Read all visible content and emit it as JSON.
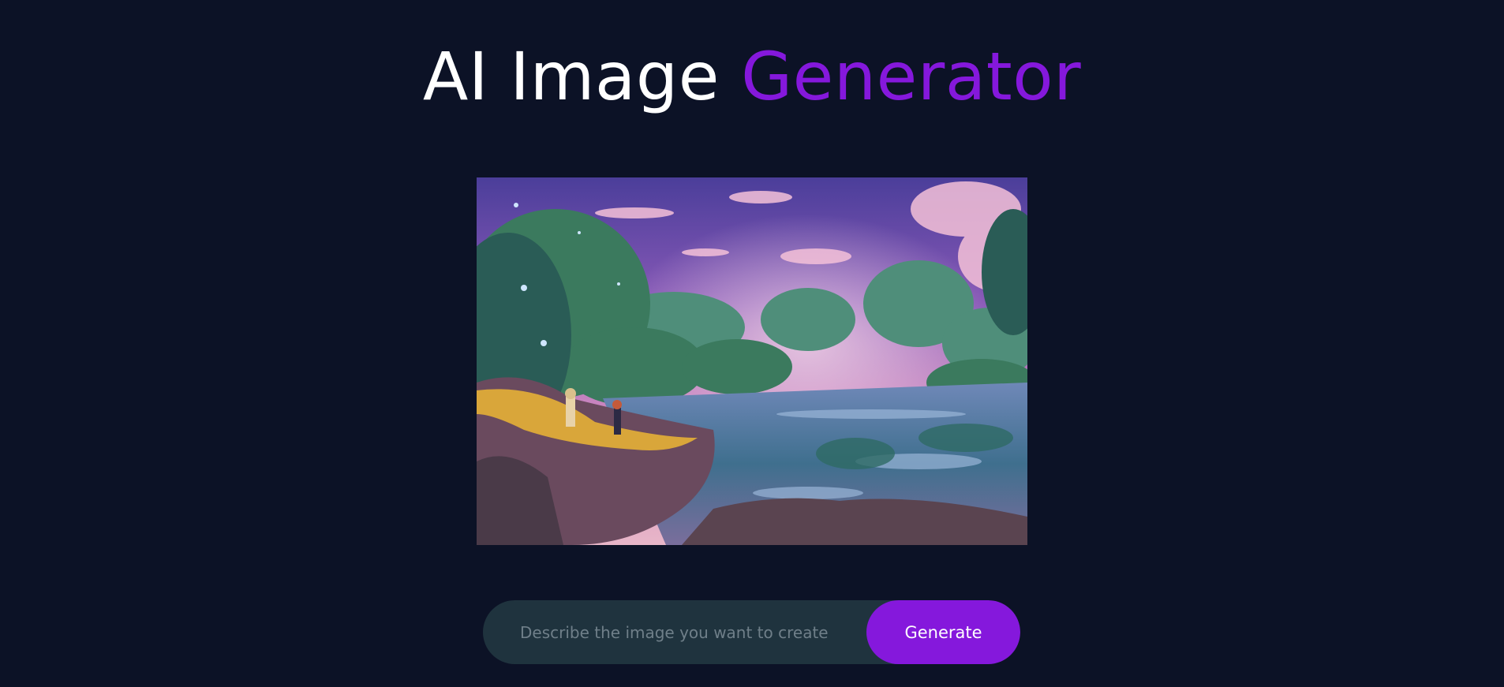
{
  "header": {
    "title_main": "AI Image",
    "title_accent": "Generator"
  },
  "preview": {
    "image_icon": "generated-landscape-image"
  },
  "prompt": {
    "value": "",
    "placeholder": "Describe the image you want to create"
  },
  "actions": {
    "generate_label": "Generate"
  },
  "colors": {
    "background": "#0c1226",
    "accent": "#8518dc",
    "input_background": "#1f333e",
    "title_text": "#ffffff"
  }
}
